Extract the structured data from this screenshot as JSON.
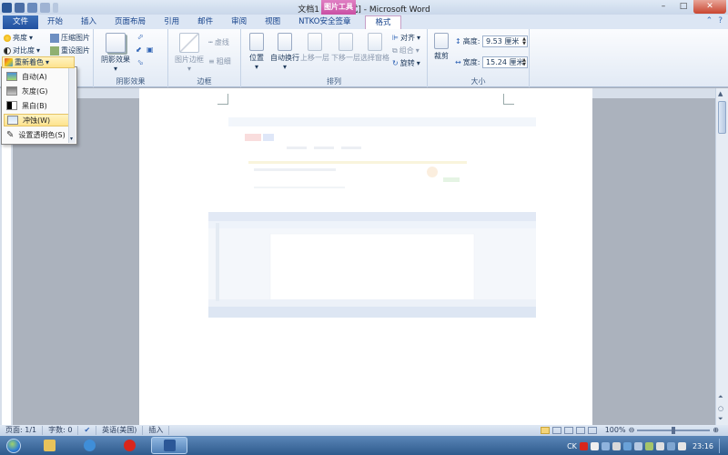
{
  "titlebar": {
    "title": "文档1 [兼容模式] - Microsoft Word",
    "tools_tab": "图片工具",
    "minimize": "–",
    "maximize": "□",
    "close": "✕"
  },
  "tabs": {
    "file": "文件",
    "home": "开始",
    "insert": "插入",
    "page_layout": "页面布局",
    "references": "引用",
    "mailings": "邮件",
    "review": "审阅",
    "view": "视图",
    "ntko": "NTKO安全签章",
    "format": "格式"
  },
  "ribbon": {
    "adjust": {
      "brightness": "亮度",
      "contrast": "对比度",
      "recolor": "重新着色",
      "compress": "压缩图片",
      "reset": "重设图片"
    },
    "shadow": {
      "shadow_effects": "阴影效果",
      "label": "阴影效果"
    },
    "border": {
      "picture_border": "图片边框",
      "dashes": "虚线",
      "weight": "粗细",
      "label": "边框"
    },
    "arrange": {
      "position": "位置",
      "wrap_text": "自动换行",
      "bring_forward": "上移一层",
      "send_backward": "下移一层",
      "selection_pane": "选择窗格",
      "align": "对齐",
      "group": "组合",
      "rotate": "旋转",
      "label": "排列"
    },
    "size": {
      "crop": "裁剪",
      "height_label": "高度:",
      "height_value": "9.53 厘米",
      "width_label": "宽度:",
      "width_value": "15.24 厘米",
      "label": "大小"
    }
  },
  "recolor_menu": {
    "items": [
      {
        "label": "自动(A)"
      },
      {
        "label": "灰度(G)"
      },
      {
        "label": "黑白(B)"
      },
      {
        "label": "冲蚀(W)"
      },
      {
        "label": "设置透明色(S)"
      }
    ],
    "selected_index": 3
  },
  "statusbar": {
    "page": "页面: 1/1",
    "words": "字数: 0",
    "language": "英语(美国)",
    "mode": "插入",
    "zoom": "100%"
  },
  "taskbar": {
    "ime": "CK",
    "time": "23:16"
  },
  "colors": {
    "file_tab": "#2251a0",
    "tools_tab": "#c94fa3",
    "menu_highlight": "#fde38e"
  }
}
